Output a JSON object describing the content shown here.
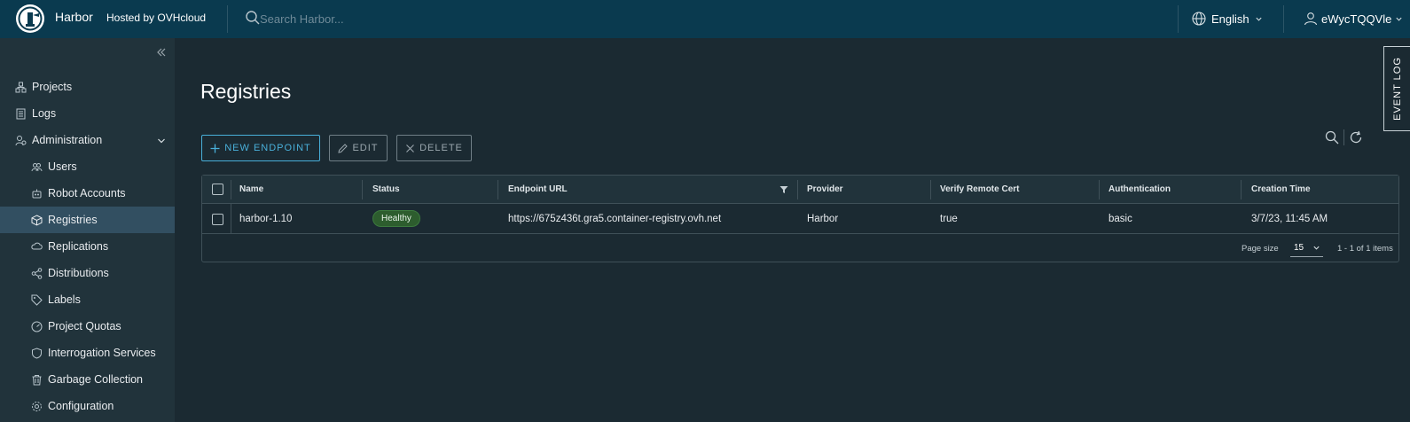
{
  "header": {
    "brand": "Harbor",
    "hosted_by": "Hosted by OVHcloud",
    "search_placeholder": "Search Harbor...",
    "language": "English",
    "username": "eWycTQQVle"
  },
  "sidebar": {
    "items": [
      {
        "label": "Projects",
        "icon": "projects-icon"
      },
      {
        "label": "Logs",
        "icon": "logs-icon"
      },
      {
        "label": "Administration",
        "icon": "administration-icon"
      }
    ],
    "admin_items": [
      {
        "label": "Users",
        "icon": "users-icon"
      },
      {
        "label": "Robot Accounts",
        "icon": "robot-icon"
      },
      {
        "label": "Registries",
        "icon": "registries-icon",
        "active": true
      },
      {
        "label": "Replications",
        "icon": "replications-icon"
      },
      {
        "label": "Distributions",
        "icon": "distributions-icon"
      },
      {
        "label": "Labels",
        "icon": "labels-icon"
      },
      {
        "label": "Project Quotas",
        "icon": "quotas-icon"
      },
      {
        "label": "Interrogation Services",
        "icon": "shield-icon"
      },
      {
        "label": "Garbage Collection",
        "icon": "trash-icon"
      },
      {
        "label": "Configuration",
        "icon": "gear-icon"
      }
    ]
  },
  "main": {
    "title": "Registries",
    "toolbar": {
      "new_endpoint": "NEW ENDPOINT",
      "edit": "EDIT",
      "delete": "DELETE"
    },
    "event_log": "EVENT LOG"
  },
  "table": {
    "columns": [
      "Name",
      "Status",
      "Endpoint URL",
      "Provider",
      "Verify Remote Cert",
      "Authentication",
      "Creation Time"
    ],
    "rows": [
      {
        "name": "harbor-1.10",
        "status": "Healthy",
        "endpoint_url": "https://675z436t.gra5.container-registry.ovh.net",
        "provider": "Harbor",
        "verify_remote_cert": "true",
        "authentication": "basic",
        "creation_time": "3/7/23, 11:45 AM"
      }
    ],
    "footer": {
      "page_size_label": "Page size",
      "page_size": "15",
      "count": "1 - 1 of 1 items"
    }
  },
  "colors": {
    "header_bg": "#0a3a4f",
    "sidebar_bg": "#21333b",
    "main_bg": "#1b2a32",
    "active_item": "#324f61",
    "accent": "#49afd9",
    "healthy": "#2d5d2e"
  }
}
